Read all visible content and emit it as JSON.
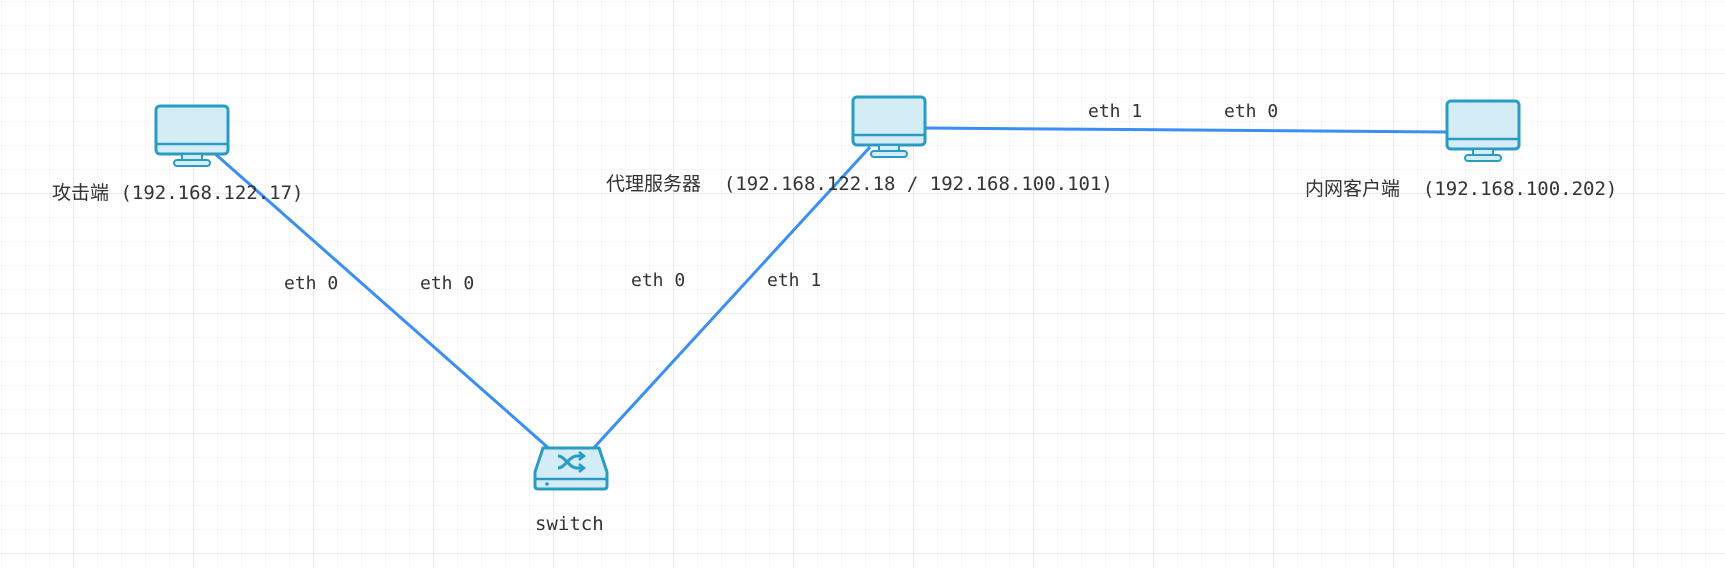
{
  "nodes": {
    "attacker": {
      "name": "攻击端",
      "ip": "(192.168.122.17)",
      "icon": "monitor-icon"
    },
    "proxy": {
      "name": "代理服务器",
      "ip": "(192.168.122.18 / 192.168.100.101)",
      "icon": "monitor-icon"
    },
    "client": {
      "name": "内网客户端",
      "ip": "(192.168.100.202)",
      "icon": "monitor-icon"
    },
    "switch": {
      "name": "switch",
      "icon": "switch-icon"
    }
  },
  "links": [
    {
      "from": "attacker",
      "to": "switch",
      "from_port": "eth 0",
      "to_port": "eth 0"
    },
    {
      "from": "switch",
      "to": "proxy",
      "from_port": "eth 0",
      "to_port": "eth 1"
    },
    {
      "from": "proxy",
      "to": "client",
      "from_port": "eth 1",
      "to_port": "eth 0"
    }
  ],
  "colors": {
    "link": "#3a8ef6",
    "icon_stroke": "#2a9bc5",
    "icon_fill": "#d4ecf6",
    "grid": "#eaeaea"
  }
}
